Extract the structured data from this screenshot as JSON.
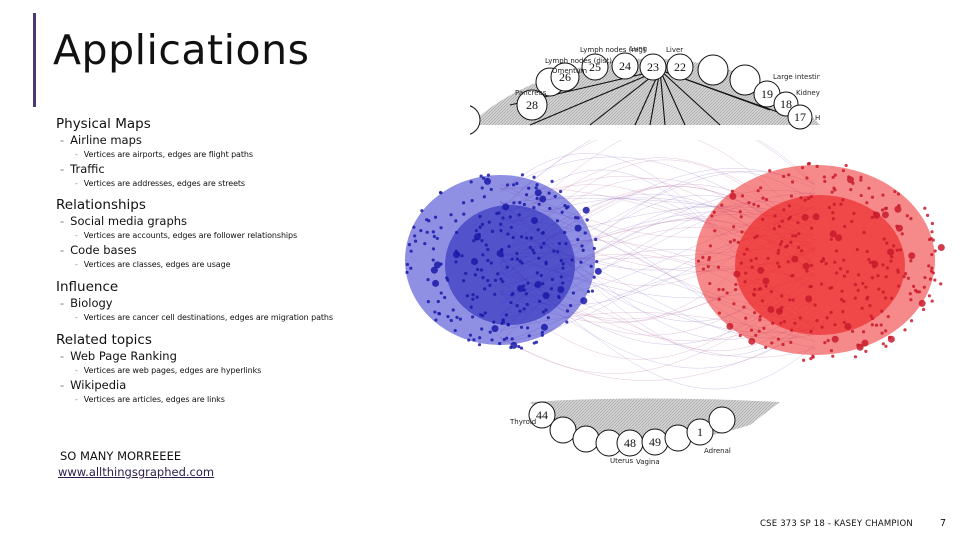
{
  "slide": {
    "title": "Applications",
    "accent_color": "#4b3b75",
    "sections": [
      {
        "heading": "Physical Maps",
        "items": [
          {
            "label": "Airline maps",
            "detail": "Vertices are airports, edges are flight paths"
          },
          {
            "label": "Traffic",
            "detail": "Vertices are addresses, edges are streets"
          }
        ]
      },
      {
        "heading": "Relationships",
        "items": [
          {
            "label": "Social media graphs",
            "detail": "Vertices are accounts, edges are follower relationships"
          },
          {
            "label": "Code bases",
            "detail": "Vertices are classes, edges are usage"
          }
        ]
      },
      {
        "heading": "Influence",
        "items": [
          {
            "label": "Biology",
            "detail": "Vertices are cancer cell destinations, edges are migration paths"
          }
        ]
      },
      {
        "heading": "Related topics",
        "items": [
          {
            "label": "Web Page Ranking",
            "detail": "Vertices are web pages, edges are hyperlinks"
          },
          {
            "label": "Wikipedia",
            "detail": "Vertices are articles, edges are links"
          }
        ]
      }
    ],
    "more_text": "SO MANY MORREEEE",
    "link_text": "www.allthingsgraphed.com",
    "footer": "CSE 373 SP 18 - KASEY CHAMPION",
    "page_number": "7"
  },
  "cancer_diagram": {
    "top_labels": [
      "Lymph nodes (reg)",
      "Lung",
      "Liver",
      "Lymph nodes (dist)",
      "Omentum",
      "Pancreas",
      "Large intestine",
      "Kidney",
      "Heart"
    ],
    "bottom_labels": [
      "Thyroid",
      "Uterus",
      "Vagina",
      "Adrenal"
    ],
    "top_nodes": [
      "28",
      "26",
      "25",
      "24",
      "23",
      "22",
      "19",
      "18",
      "17"
    ],
    "bottom_nodes": [
      "44",
      "48",
      "49",
      "1"
    ]
  },
  "network_image": {
    "left_cluster_color": "#2b2bd0",
    "right_cluster_color": "#e81c24"
  }
}
